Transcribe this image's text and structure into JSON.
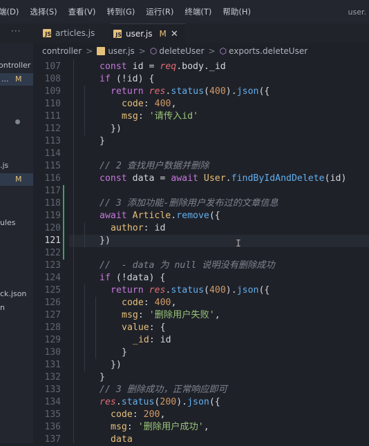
{
  "menu": {
    "items": [
      "端(D)",
      "选择(S)",
      "查看(V)",
      "转到(G)",
      "运行(R)",
      "终端(T)",
      "帮助(H)"
    ],
    "window_title": "user."
  },
  "tabs": {
    "more": "···",
    "items": [
      {
        "label": "articles.js",
        "badge": "JS"
      },
      {
        "label": "user.js",
        "badge": "JS",
        "modified": "M",
        "close": "✕"
      }
    ]
  },
  "sidebar": {
    "items": [
      "ontroller",
      "...",
      "M",
      ".js",
      "M",
      "ules",
      "ck.json",
      "n"
    ]
  },
  "breadcrumb": {
    "folder": "controller",
    "file": "user.js",
    "symbol1": "deleteUser",
    "symbol2": "exports.deleteUser"
  },
  "editor": {
    "line_numbers": [
      "107",
      "108",
      "109",
      "110",
      "111",
      "112",
      "113",
      "114",
      "115",
      "116",
      "117",
      "118",
      "119",
      "120",
      "121",
      "122",
      "123",
      "124",
      "125",
      "126",
      "127",
      "128",
      "129",
      "130",
      "131",
      "132",
      "133",
      "134",
      "135",
      "136",
      "137"
    ],
    "active_line": "121",
    "tokens": {
      "const": "const",
      "if": "if",
      "return": "return",
      "await": "await",
      "id": "id",
      "data": "data",
      "req": "req",
      "body": "body",
      "_id": "_id",
      "res": "res",
      "status": "status",
      "json": "json",
      "code": "code",
      "msg": "msg",
      "value": "value",
      "author": "author",
      "User": "User",
      "Article": "Article",
      "findByIdAndDelete": "findByIdAndDelete",
      "remove": "remove",
      "n400": "400",
      "n200": "200",
      "s_missing_id": "'请传入id'",
      "s_fail": "'删除用户失败'",
      "s_success": "'删除用户成功'",
      "c116": "// 2 查找用户数据并删除",
      "c119": "// 3 添加功能-删除用户发布过的文章信息",
      "c124": "//  - data 为 null 说明没有删除成功",
      "c134": "// 3 删除成功，正常响应即可"
    }
  }
}
